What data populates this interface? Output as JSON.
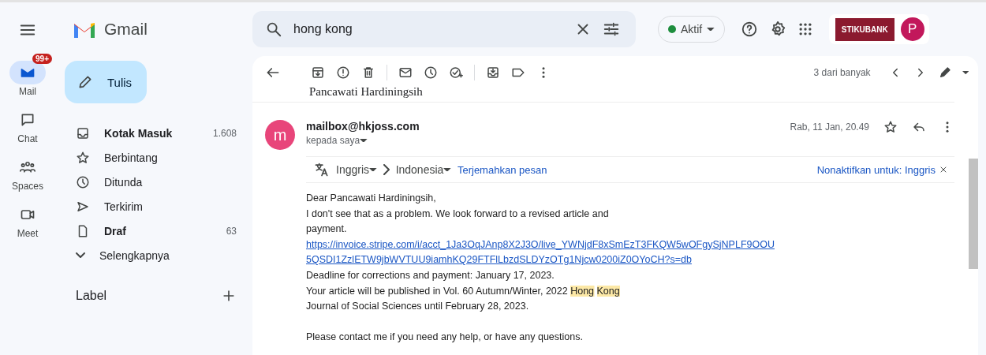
{
  "rail": [
    {
      "label": "Mail",
      "badge": "99+",
      "selected": true
    },
    {
      "label": "Chat",
      "selected": false
    },
    {
      "label": "Spaces",
      "selected": false
    },
    {
      "label": "Meet",
      "selected": false
    }
  ],
  "app": {
    "name": "Gmail"
  },
  "compose": {
    "label": "Tulis"
  },
  "folders": [
    {
      "label": "Kotak Masuk",
      "count": "1.608",
      "unread": true
    },
    {
      "label": "Berbintang",
      "unread": false
    },
    {
      "label": "Ditunda",
      "unread": false
    },
    {
      "label": "Terkirim",
      "unread": false
    },
    {
      "label": "Draf",
      "count": "63",
      "unread": true
    },
    {
      "label": "Selengkapnya",
      "unread": false
    }
  ],
  "labels": {
    "title": "Label"
  },
  "search": {
    "value": "hong kong"
  },
  "status": {
    "label": "Aktif",
    "online": true
  },
  "org": {
    "name": "STIKUBANK"
  },
  "account": {
    "initial": "P"
  },
  "toolbar": {
    "position": "3 dari banyak"
  },
  "previous_message": {
    "signature": "Pancawati Hardiningsih"
  },
  "message": {
    "avatar": "m",
    "sender": "mailbox@hkjoss.com",
    "recipient": "kepada saya",
    "date": "Rab, 11 Jan, 20.49",
    "translate": {
      "from": "Inggris",
      "to": "Indonesia",
      "action": "Terjemahkan pesan",
      "disable": "Nonaktifkan untuk: Inggris"
    },
    "body": [
      {
        "kind": "text",
        "parts": [
          {
            "text": "Dear  Pancawati Hardiningsih,",
            "highlight": false
          }
        ]
      },
      {
        "kind": "text",
        "parts": [
          {
            "text": "I don't see that as a problem. We look forward to a revised article and",
            "highlight": false
          }
        ]
      },
      {
        "kind": "text",
        "parts": [
          {
            "text": "payment.",
            "highlight": false
          }
        ]
      },
      {
        "kind": "link",
        "parts": [
          {
            "text": "https://invoice.stripe.com/i/acct_1Ja3OqJAnp8X2J3O/live_YWNjdF8xSmEzT3FKQW5wOFgySjNPLF9OOU",
            "highlight": false
          }
        ]
      },
      {
        "kind": "link",
        "parts": [
          {
            "text": "5QSDI1ZzlETW9jbWVTUU9iamhKQ29FTFlLbzdSLDYzOTg1Njcw0200iZ0OYoCH?s=db",
            "highlight": false
          }
        ]
      },
      {
        "kind": "text",
        "parts": [
          {
            "text": "Deadline for corrections and payment: January 17, 2023.",
            "highlight": false
          }
        ]
      },
      {
        "kind": "text",
        "parts": [
          {
            "text": "Your article will be published in Vol. 60 Autumn/Winter, 2022 ",
            "highlight": false
          },
          {
            "text": "Hong ",
            "highlight": true
          },
          {
            "text": "Kong",
            "highlight": true
          }
        ]
      },
      {
        "kind": "text",
        "parts": [
          {
            "text": "Journal of Social Sciences until February 28, 2023.",
            "highlight": false
          }
        ]
      },
      {
        "kind": "gap"
      },
      {
        "kind": "text",
        "parts": [
          {
            "text": "Please contact me if you need any help, or have any questions.",
            "highlight": false
          }
        ]
      }
    ]
  }
}
